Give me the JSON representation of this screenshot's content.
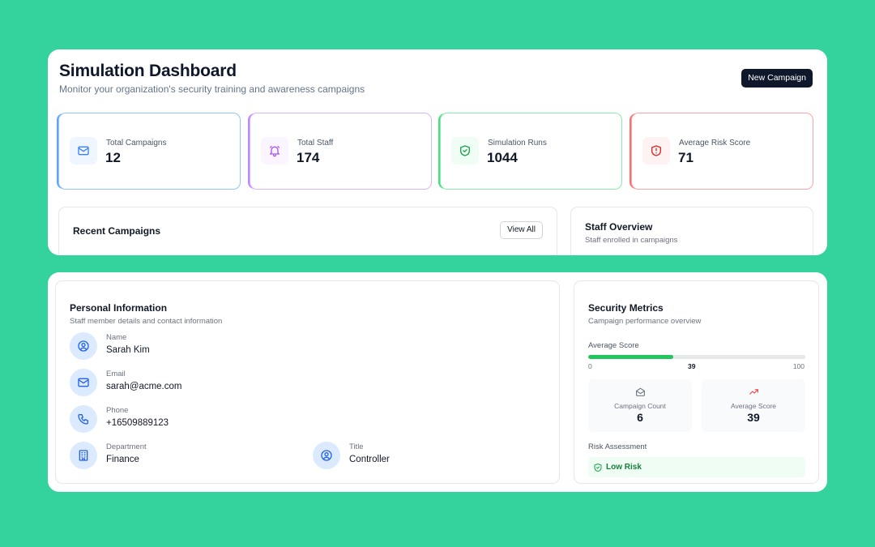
{
  "header": {
    "title": "Simulation Dashboard",
    "subtitle": "Monitor your organization's security training and awareness campaigns",
    "new_campaign_label": "New Campaign"
  },
  "stats": [
    {
      "label": "Total Campaigns",
      "value": "12",
      "icon": "mail-icon",
      "accent": "#60a5fa"
    },
    {
      "label": "Total Staff",
      "value": "174",
      "icon": "bell-icon",
      "accent": "#c084fc"
    },
    {
      "label": "Simulation Runs",
      "value": "1044",
      "icon": "shield-check-icon",
      "accent": "#4ade80"
    },
    {
      "label": "Average Risk Score",
      "value": "71",
      "icon": "shield-alert-icon",
      "accent": "#f87171"
    }
  ],
  "recent_campaigns": {
    "title": "Recent Campaigns",
    "view_all_label": "View All"
  },
  "staff_overview": {
    "title": "Staff Overview",
    "subtitle": "Staff enrolled in campaigns"
  },
  "personal": {
    "title": "Personal Information",
    "subtitle": "Staff member details and contact information",
    "fields": [
      {
        "label": "Name",
        "value": "Sarah Kim",
        "icon": "user-circle-icon"
      },
      {
        "label": "Email",
        "value": "sarah@acme.com",
        "icon": "mail-icon"
      },
      {
        "label": "Phone",
        "value": "+16509889123",
        "icon": "phone-icon"
      },
      {
        "label": "Department",
        "value": "Finance",
        "icon": "building-icon"
      },
      {
        "label": "Title",
        "value": "Controller",
        "icon": "user-circle-icon"
      }
    ]
  },
  "metrics": {
    "title": "Security Metrics",
    "subtitle": "Campaign performance overview",
    "average_score_label": "Average Score",
    "average_score": 39,
    "scale_min": "0",
    "scale_current": "39",
    "scale_max": "100",
    "campaign_count_label": "Campaign Count",
    "campaign_count": "6",
    "avg_score_card_label": "Average Score",
    "avg_score_card_value": "39",
    "risk_label": "Risk Assessment",
    "risk_value": "Low Risk",
    "risk_color": "#15803d"
  }
}
